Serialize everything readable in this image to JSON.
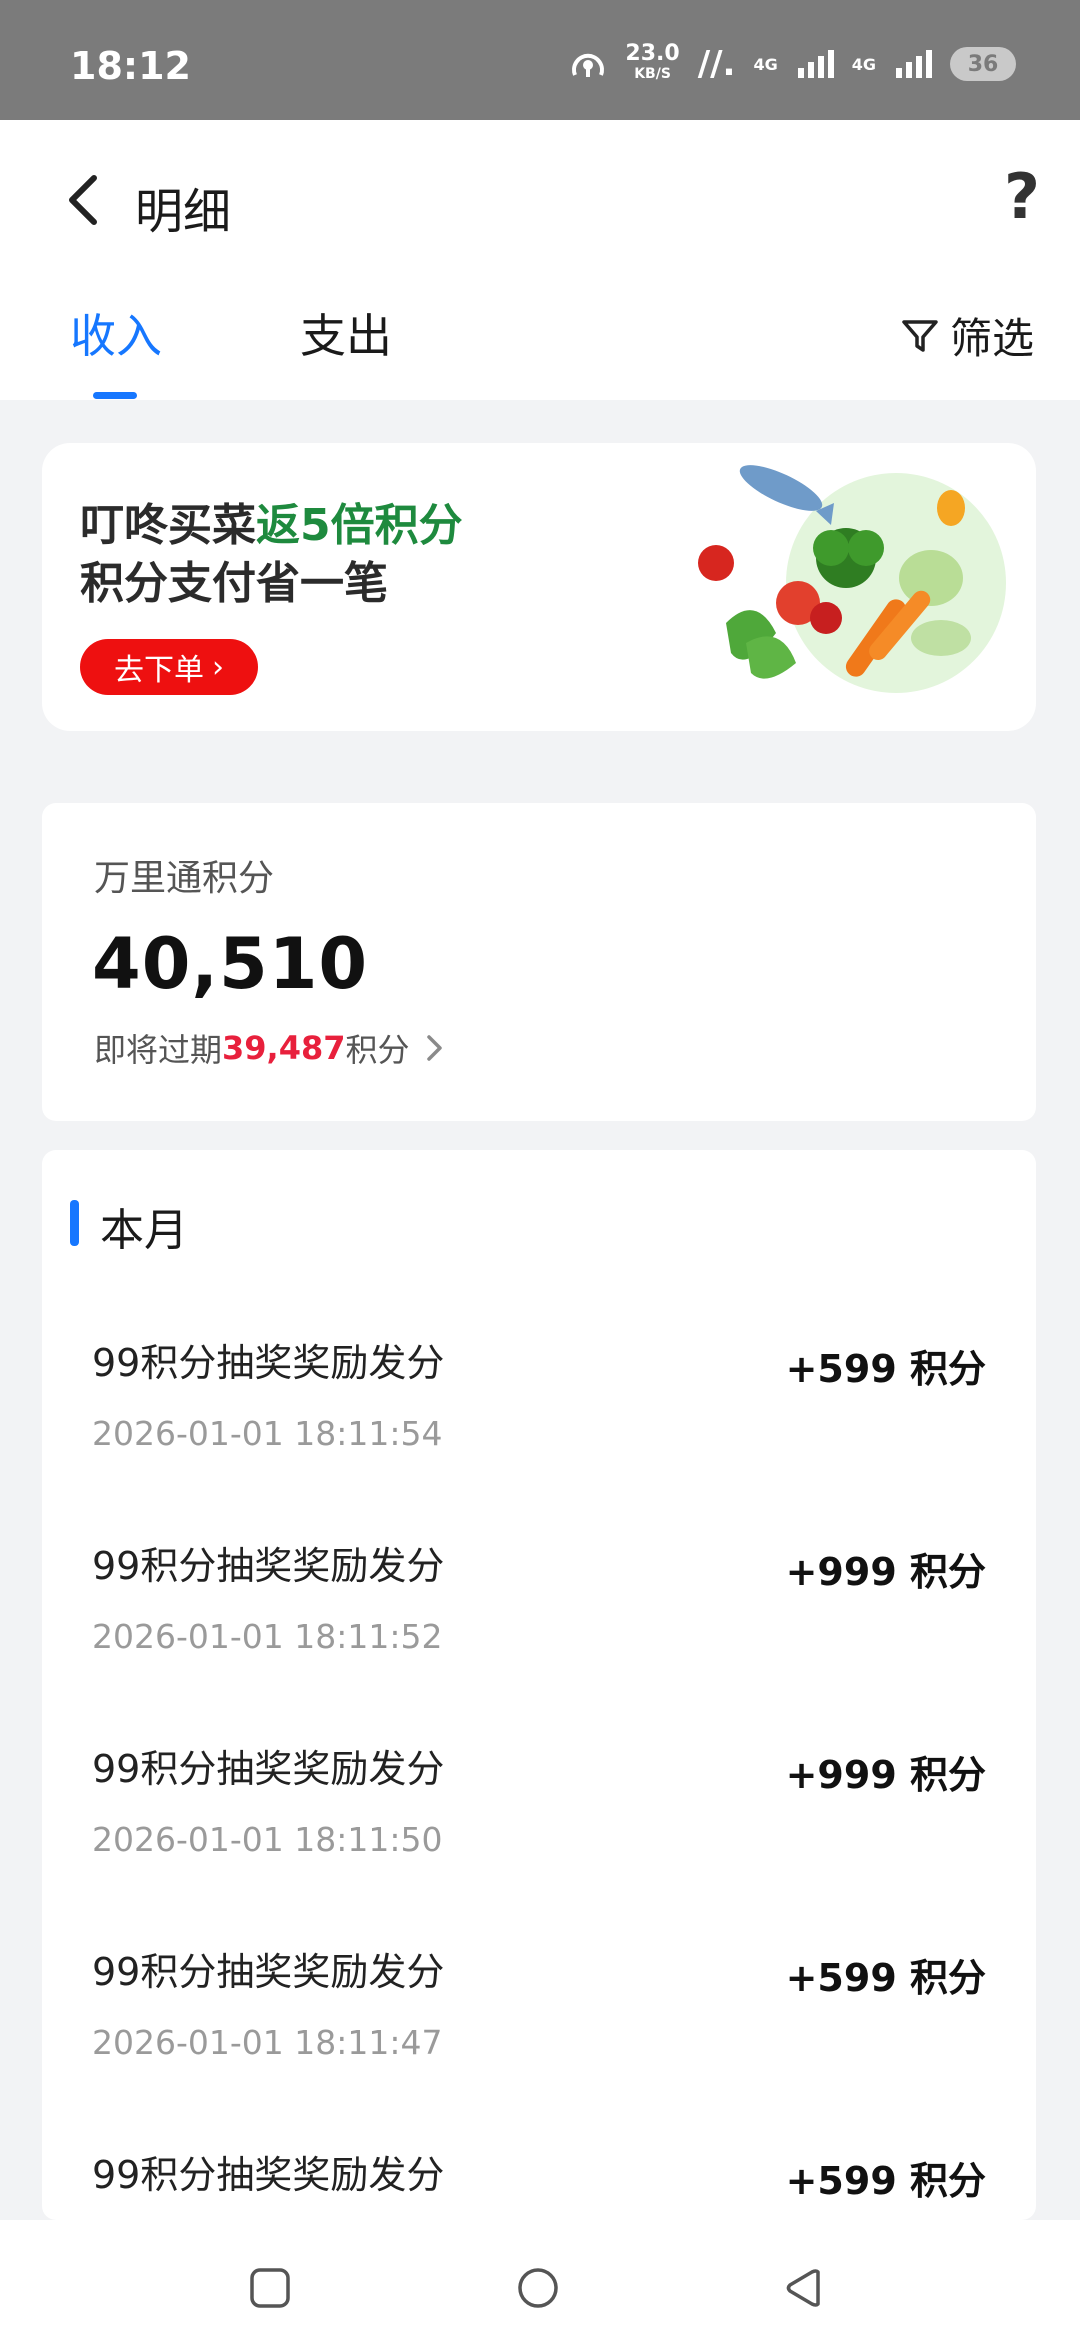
{
  "status": {
    "time": "18:12",
    "speed_value": "23.0",
    "speed_unit": "KB/S",
    "net1": "4G",
    "net2": "4G",
    "battery": "36"
  },
  "header": {
    "title": "明细",
    "tabs": [
      {
        "label": "收入",
        "active": true
      },
      {
        "label": "支出",
        "active": false
      }
    ],
    "filter_label": "筛选"
  },
  "banner": {
    "line1_prefix": "叮咚买菜",
    "line1_highlight": "返5倍积分",
    "line2": "积分支付省一笔",
    "button_label": "去下单",
    "button_chevron": "›"
  },
  "points_card": {
    "label": "万里通积分",
    "points": "40,510",
    "expire_prefix": "即将过期",
    "expire_amount": "39,487",
    "expire_suffix": "积分"
  },
  "list": {
    "month_title": "本月",
    "items": [
      {
        "title": "99积分抽奖奖励发分",
        "date": "2026-01-01 18:11:54",
        "amount": "+599 积分"
      },
      {
        "title": "99积分抽奖奖励发分",
        "date": "2026-01-01 18:11:52",
        "amount": "+999 积分"
      },
      {
        "title": "99积分抽奖奖励发分",
        "date": "2026-01-01 18:11:50",
        "amount": "+999 积分"
      },
      {
        "title": "99积分抽奖奖励发分",
        "date": "2026-01-01 18:11:47",
        "amount": "+599 积分"
      },
      {
        "title": "99积分抽奖奖励发分",
        "date": "",
        "amount": "+599 积分"
      }
    ]
  },
  "colors": {
    "accent": "#1677ff",
    "highlight_green": "#1e8a3e",
    "button_red": "#ee1010",
    "expire_red": "#e8203c"
  },
  "icons": [
    "back-icon",
    "help-icon",
    "filter-icon",
    "chevron-right-icon",
    "square-nav-icon",
    "circle-nav-icon",
    "triangle-nav-icon"
  ]
}
